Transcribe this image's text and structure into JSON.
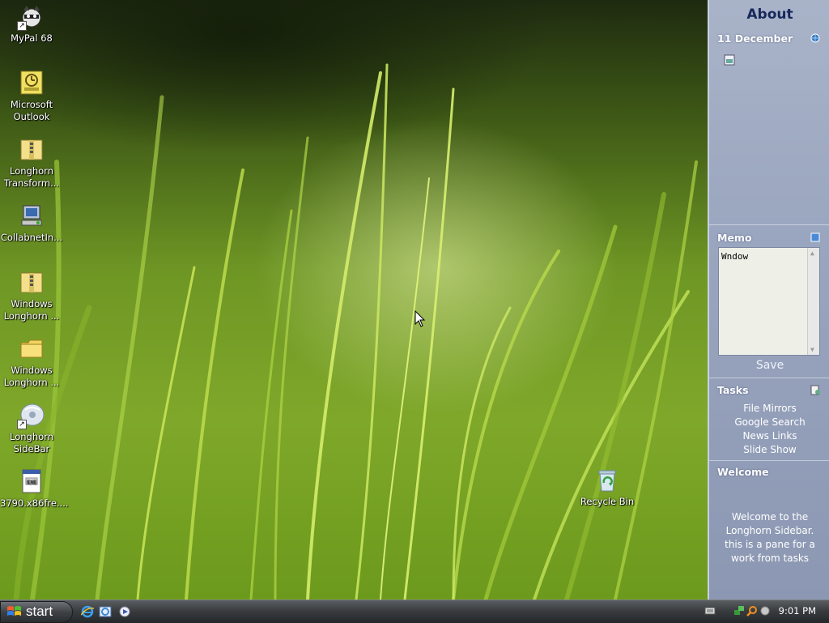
{
  "desktop": {
    "icons": [
      {
        "label": "MyPal 68",
        "icon": "raccoon-app-icon"
      },
      {
        "label": "Microsoft\nOutlook",
        "icon": "outlook-icon"
      },
      {
        "label": "Longhorn\nTransform...",
        "icon": "zip-folder-icon"
      },
      {
        "label": "CollabnetIn...",
        "icon": "installer-icon"
      },
      {
        "label": "Windows\nLonghorn ...",
        "icon": "zip-folder-icon"
      },
      {
        "label": "Windows\nLonghorn ...",
        "icon": "folder-icon"
      },
      {
        "label": "Longhorn\nSideBar",
        "icon": "disc-icon"
      },
      {
        "label": "3790.x86fre....",
        "icon": "document-icon"
      },
      {
        "label": "Recycle Bin",
        "icon": "recycle-bin-icon"
      }
    ]
  },
  "sidebar": {
    "title": "About",
    "date": "11 December",
    "memo": {
      "label": "Memo",
      "text": "Wndow",
      "save_label": "Save"
    },
    "tasks": {
      "label": "Tasks",
      "items": [
        "File Mirrors",
        "Google Search",
        "News Links",
        "Slide Show"
      ]
    },
    "welcome": {
      "label": "Welcome",
      "text": "Welcome to the Longhorn Sidebar. this is a pane for a work from tasks"
    }
  },
  "taskbar": {
    "start_label": "start",
    "quick_launch": [
      "ie-icon",
      "browser-icon",
      "media-player-icon"
    ],
    "tray_icons": [
      "keyboard-icon",
      "network-icon",
      "search-icon",
      "volume-icon"
    ],
    "clock": "9:01 PM"
  },
  "colors": {
    "sidebar_bg": "#9aa6bf",
    "sidebar_title": "#17285a",
    "taskbar_bg": "#3a3d40"
  }
}
